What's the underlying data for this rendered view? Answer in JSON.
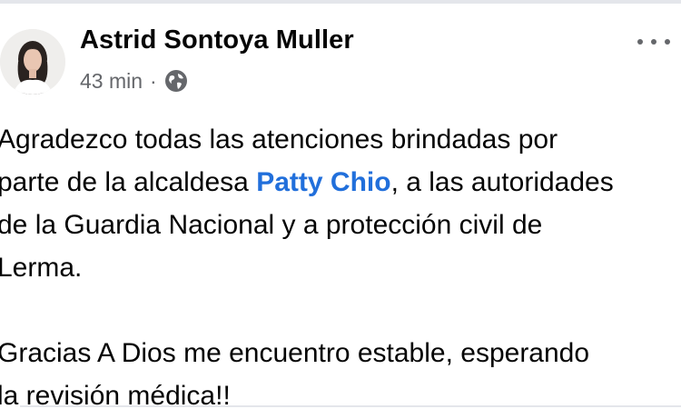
{
  "post": {
    "author_name": "Astrid Sontoya Muller",
    "time_ago": "43 min",
    "separator": "·",
    "audience_icon": "globe-icon",
    "more_icon": "more-options-icon",
    "body": {
      "line1": "Agradezco todas las atenciones brindadas por",
      "line2_before": "parte de la alcaldesa ",
      "mention": "Patty Chio",
      "line2_after": ", a las autoridades",
      "line3": "de la Guardia Nacional y a protección civil de",
      "line4": "Lerma.",
      "line5": "Gracias A Dios me encuentro estable, esperando",
      "line6": "la revisión médica!!"
    }
  },
  "colors": {
    "mention": "#216fdb",
    "meta_text": "#65676b",
    "body_text": "#050505"
  }
}
